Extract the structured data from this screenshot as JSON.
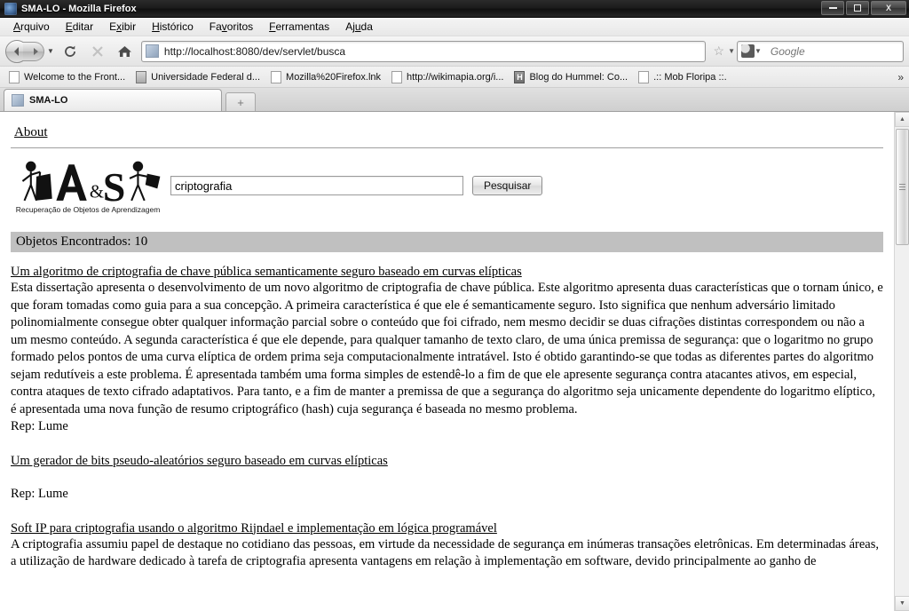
{
  "window": {
    "title": "SMA-LO - Mozilla Firefox",
    "minimize_label": "Minimize",
    "maximize_label": "Restore",
    "close_label": "X"
  },
  "menubar": {
    "items": [
      {
        "pre": "",
        "accel": "A",
        "post": "rquivo"
      },
      {
        "pre": "",
        "accel": "E",
        "post": "ditar"
      },
      {
        "pre": "E",
        "accel": "x",
        "post": "ibir"
      },
      {
        "pre": "",
        "accel": "H",
        "post": "istórico"
      },
      {
        "pre": "Fa",
        "accel": "v",
        "post": "oritos"
      },
      {
        "pre": "",
        "accel": "F",
        "post": "erramentas"
      },
      {
        "pre": "Aj",
        "accel": "u",
        "post": "da"
      }
    ]
  },
  "toolbar": {
    "back_icon": "back-arrow-icon",
    "forward_icon": "forward-arrow-icon",
    "history_dropdown_icon": "chevron-down-icon",
    "reload_icon": "reload-icon",
    "stop_icon": "stop-icon",
    "home_icon": "home-icon",
    "url": "http://localhost:8080/dev/servlet/busca",
    "bookmark_star_icon": "star-icon",
    "search_placeholder": "Google",
    "search_value": "",
    "magnifier_icon": "magnifier-icon"
  },
  "bookmarks": {
    "items": [
      {
        "label": "Welcome to the Front...",
        "icon": "page-icon"
      },
      {
        "label": "Universidade Federal d...",
        "icon": "university-icon"
      },
      {
        "label": "Mozilla%20Firefox.lnk",
        "icon": "page-icon"
      },
      {
        "label": "http://wikimapia.org/i...",
        "icon": "page-icon"
      },
      {
        "label": "Blog do Hummel: Co...",
        "icon": "letter-h-icon"
      },
      {
        "label": ".:: Mob Floripa ::.",
        "icon": "page-icon"
      }
    ],
    "overflow_label": "»"
  },
  "tabs": {
    "items": [
      {
        "label": "SMA-LO",
        "favicon": "site-favicon"
      }
    ],
    "newtab_label": "+"
  },
  "page": {
    "about_link": "About",
    "logo": {
      "text": "A & S",
      "caption": "Recuperação de Objetos de Aprendizagem"
    },
    "search": {
      "value": "criptografia",
      "placeholder": "",
      "button_label": "Pesquisar"
    },
    "results_header": "Objetos Encontrados: 10",
    "results": [
      {
        "title": "Um algoritmo de criptografia de chave pública semanticamente seguro baseado em curvas elípticas",
        "description": "Esta dissertação apresenta o desenvolvimento de um novo algoritmo de criptografia de chave pública. Este algoritmo apresenta duas características que o tornam único, e que foram tomadas como guia para a sua concepção. A primeira característica é que ele é semanticamente seguro. Isto significa que nenhum adversário limitado polinomialmente consegue obter qualquer informação parcial sobre o conteúdo que foi cifrado, nem mesmo decidir se duas cifrações distintas correspondem ou não a um mesmo conteúdo. A segunda característica é que ele depende, para qualquer tamanho de texto claro, de uma única premissa de segurança: que o logaritmo no grupo formado pelos pontos de uma curva elíptica de ordem prima seja computacionalmente intratável. Isto é obtido garantindo-se que todas as diferentes partes do algoritmo sejam redutíveis a este problema. É apresentada também uma forma simples de estendê-lo a fim de que ele apresente segurança contra atacantes ativos, em especial, contra ataques de texto cifrado adaptativos. Para tanto, e a fim de manter a premissa de que a segurança do algoritmo seja unicamente dependente do logaritmo elíptico, é apresentada uma nova função de resumo criptográfico (hash) cuja segurança é baseada no mesmo problema.",
        "rep": "Rep: Lume"
      },
      {
        "title": "Um gerador de bits pseudo-aleatórios seguro baseado em curvas elípticas",
        "description": "",
        "rep": "Rep: Lume"
      },
      {
        "title": "Soft IP para criptografia usando o algoritmo Rijndael e implementação em lógica programável",
        "description": "A criptografia assumiu papel de destaque no cotidiano das pessoas, em virtude da necessidade de segurança em inúmeras transações eletrônicas. Em determinadas áreas, a utilização de hardware dedicado à tarefa de criptografia apresenta vantagens em relação à implementação em software, devido principalmente ao ganho de",
        "rep": ""
      }
    ]
  },
  "scrollbar": {
    "up_label": "▲",
    "down_label": "▼"
  },
  "colors": {
    "results_bar_bg": "#c0c0c0",
    "page_bg": "#ffffff",
    "text": "#000000"
  }
}
